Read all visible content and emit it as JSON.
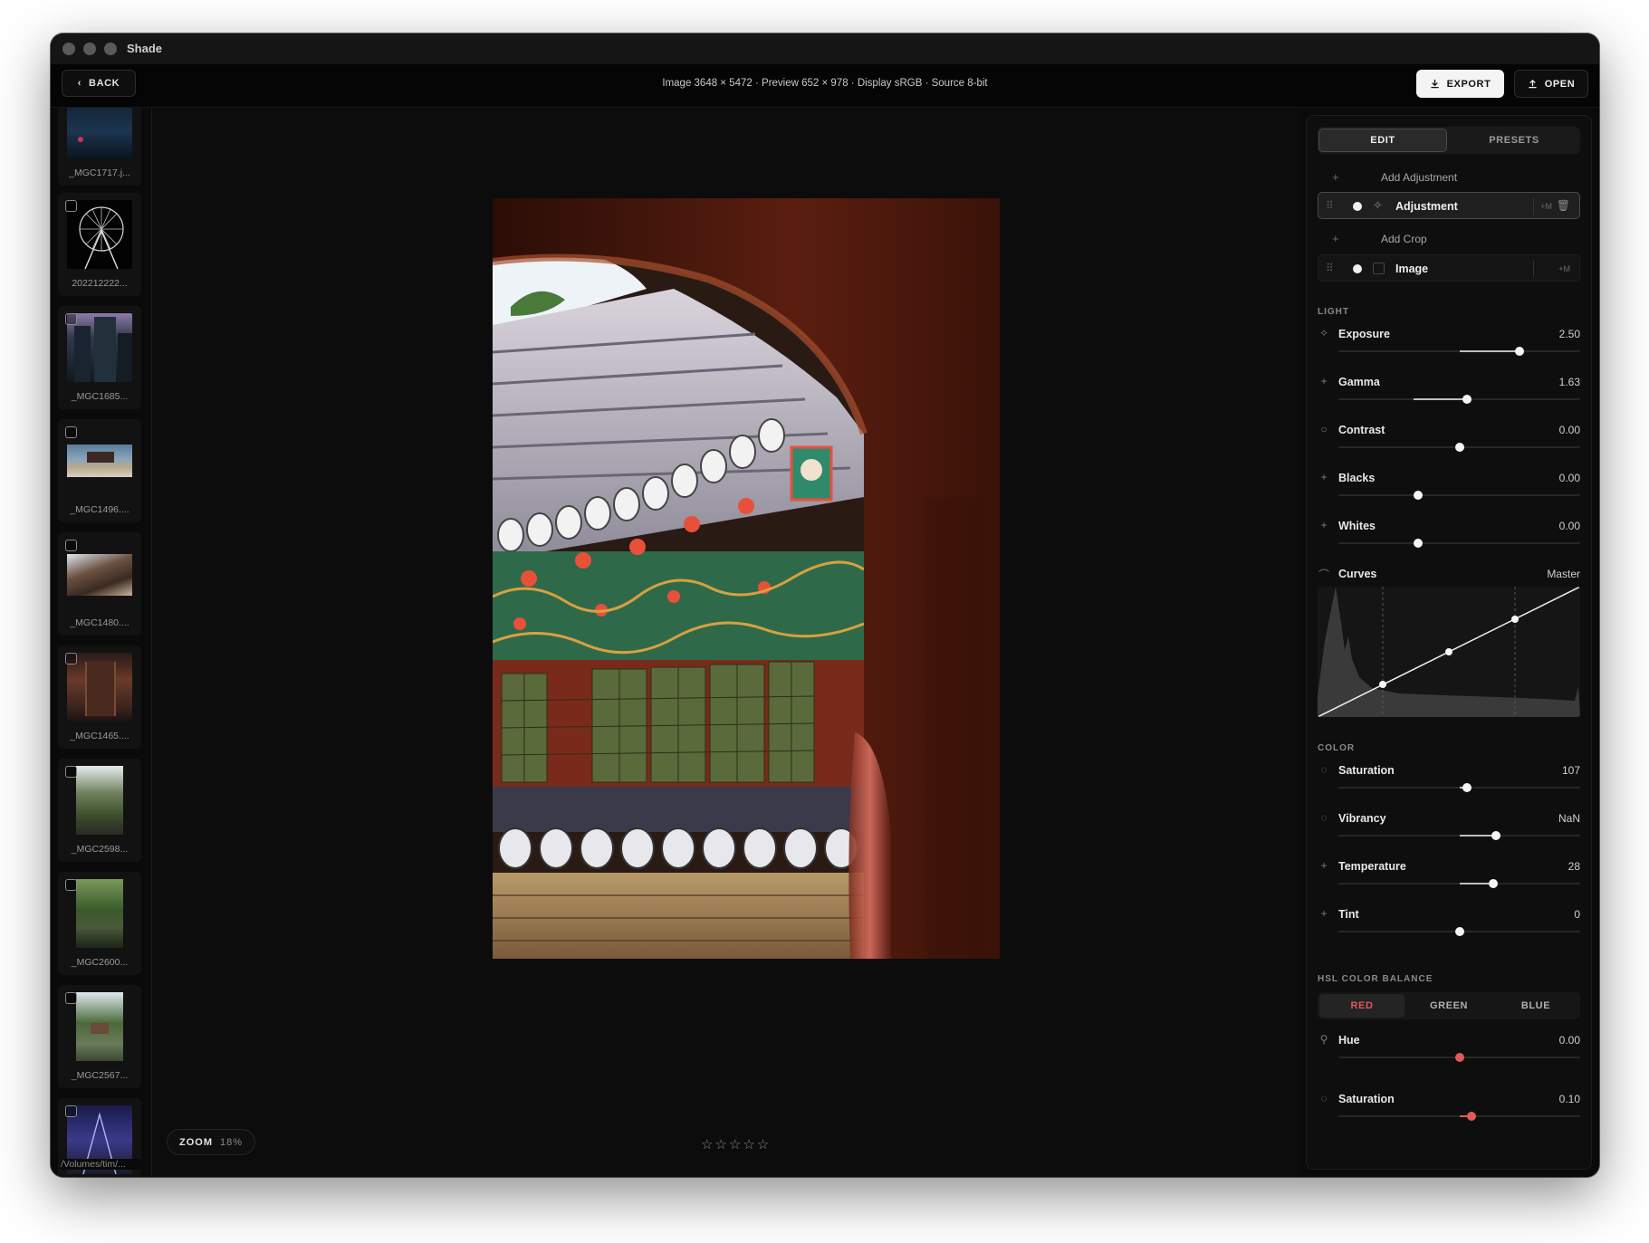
{
  "window": {
    "title": "Shade"
  },
  "toolbar": {
    "back_label": "BACK",
    "info": "Image 3648 × 5472 · Preview 652 × 978 · Display sRGB · Source 8-bit",
    "export_label": "EXPORT",
    "open_label": "OPEN"
  },
  "filmstrip": {
    "items": [
      {
        "label": "_MGC1717.j..."
      },
      {
        "label": "202212222..."
      },
      {
        "label": "_MGC1685..."
      },
      {
        "label": "_MGC1496...."
      },
      {
        "label": "_MGC1480...."
      },
      {
        "label": "_MGC1465...."
      },
      {
        "label": "_MGC2598..."
      },
      {
        "label": "_MGC2600..."
      },
      {
        "label": "_MGC2567..."
      }
    ],
    "path": "/Volumes/tim/..."
  },
  "canvas": {
    "zoom_label": "ZOOM",
    "zoom_value": "18%",
    "stars": "☆☆☆☆☆"
  },
  "panel": {
    "tabs": {
      "edit": "EDIT",
      "presets": "PRESETS"
    },
    "add_adjustment": "Add Adjustment",
    "add_crop": "Add Crop",
    "layers": [
      {
        "name": "Adjustment",
        "mask": "+M"
      },
      {
        "name": "Image",
        "mask": "+M"
      }
    ],
    "light_label": "LIGHT",
    "light": [
      {
        "label": "Exposure",
        "value": "2.50",
        "position": 0.75
      },
      {
        "label": "Gamma",
        "value": "1.63",
        "position": 0.53
      },
      {
        "label": "Contrast",
        "value": "0.00",
        "position": 0.5
      },
      {
        "label": "Blacks",
        "value": "0.00",
        "position": 0.33
      },
      {
        "label": "Whites",
        "value": "0.00",
        "position": 0.33
      }
    ],
    "curves": {
      "label": "Curves",
      "channel": "Master"
    },
    "color_label": "COLOR",
    "color": [
      {
        "label": "Saturation",
        "value": "107",
        "position": 0.53
      },
      {
        "label": "Vibrancy",
        "value": "NaN",
        "position": 0.65
      },
      {
        "label": "Temperature",
        "value": "28",
        "position": 0.64
      },
      {
        "label": "Tint",
        "value": "0",
        "position": 0.5
      }
    ],
    "hsl_label": "HSL COLOR BALANCE",
    "hsl_tabs": {
      "red": "RED",
      "green": "GREEN",
      "blue": "BLUE"
    },
    "hsl": [
      {
        "label": "Hue",
        "value": "0.00",
        "position": 0.5
      },
      {
        "label": "Saturation",
        "value": "0.10",
        "position": 0.55
      }
    ]
  },
  "colors": {
    "accent_red": "#e25a55",
    "panel_bg": "#0e0e0e",
    "window_bg": "#0b0b0b"
  }
}
